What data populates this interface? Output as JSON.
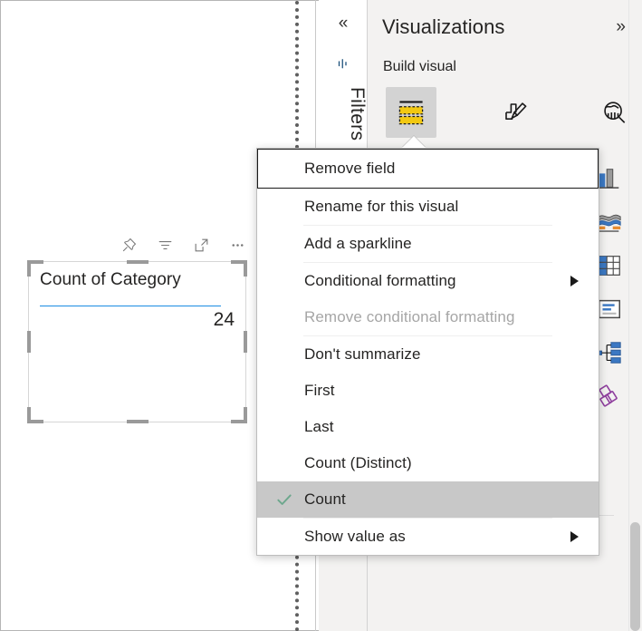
{
  "canvas": {
    "visual": {
      "title": "Count of Category",
      "value": "24",
      "accent_color": "#1b8ce3",
      "header_icons": [
        {
          "name": "pin-icon",
          "label": "Pin to dashboard"
        },
        {
          "name": "filter-icon",
          "label": "Filters and slicers affecting this visual"
        },
        {
          "name": "focus-mode-icon",
          "label": "Focus mode"
        },
        {
          "name": "more-options-icon",
          "label": "More options"
        }
      ]
    }
  },
  "filters_rail": {
    "collapse_label": "«",
    "icon_name": "filter-pane-icon",
    "label": "Filters"
  },
  "visualizations": {
    "title": "Visualizations",
    "expand_label": "»",
    "subtitle": "Build visual",
    "tabs": [
      {
        "name": "build-visual-tab",
        "label": "Build visual",
        "active": true
      },
      {
        "name": "format-visual-tab",
        "label": "Format visual",
        "active": false
      },
      {
        "name": "analytics-tab",
        "label": "Analytics",
        "active": false
      }
    ],
    "gallery": [
      {
        "name": "clustered-column-chart-icon",
        "label": "Clustered column chart"
      },
      {
        "name": "ribbon-chart-icon",
        "label": "Ribbon chart"
      },
      {
        "name": "matrix-icon",
        "label": "Matrix"
      },
      {
        "name": "card-icon",
        "label": "Card"
      },
      {
        "name": "decomposition-tree-icon",
        "label": "Decomposition tree"
      },
      {
        "name": "key-influencers-icon",
        "label": "Key influencers"
      }
    ],
    "field_well": {
      "remove_label": "×"
    }
  },
  "context_menu": {
    "items": [
      {
        "label": "Remove field",
        "state": "focused",
        "submenu": false,
        "checked": false,
        "separator_after": false
      },
      {
        "label": "Rename for this visual",
        "state": "normal",
        "submenu": false,
        "checked": false,
        "separator_after": true
      },
      {
        "label": "Add a sparkline",
        "state": "normal",
        "submenu": false,
        "checked": false,
        "separator_after": true
      },
      {
        "label": "Conditional formatting",
        "state": "normal",
        "submenu": true,
        "checked": false,
        "separator_after": false
      },
      {
        "label": "Remove conditional formatting",
        "state": "disabled",
        "submenu": false,
        "checked": false,
        "separator_after": true
      },
      {
        "label": "Don't summarize",
        "state": "normal",
        "submenu": false,
        "checked": false,
        "separator_after": false
      },
      {
        "label": "First",
        "state": "normal",
        "submenu": false,
        "checked": false,
        "separator_after": false
      },
      {
        "label": "Last",
        "state": "normal",
        "submenu": false,
        "checked": false,
        "separator_after": false
      },
      {
        "label": "Count (Distinct)",
        "state": "normal",
        "submenu": false,
        "checked": false,
        "separator_after": false
      },
      {
        "label": "Count",
        "state": "checked",
        "submenu": false,
        "checked": true,
        "separator_after": true
      },
      {
        "label": "Show value as",
        "state": "normal",
        "submenu": true,
        "checked": false,
        "separator_after": false
      }
    ],
    "checkmark_color": "#6da78d",
    "highlight_color": "#c8c8c8"
  }
}
